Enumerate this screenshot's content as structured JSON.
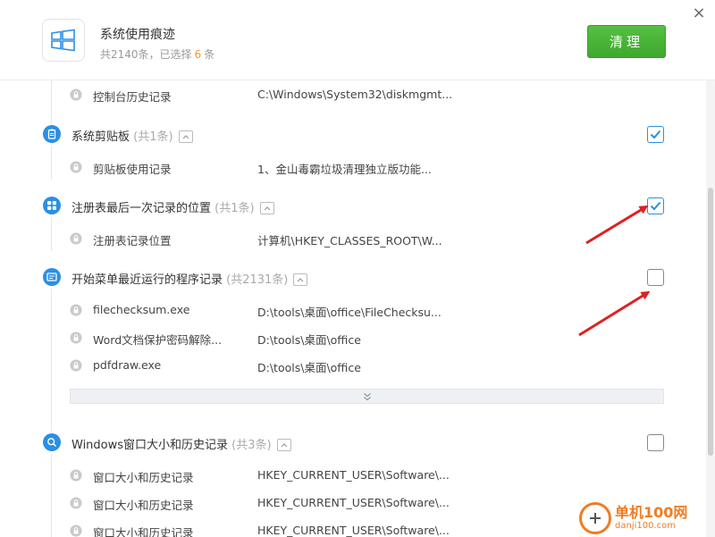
{
  "header": {
    "title": "系统使用痕迹",
    "subtitle_prefix": "共2140条，已选择",
    "selected_count": "6",
    "subtitle_suffix": "条",
    "clean_label": "清理",
    "close_glyph": "×"
  },
  "colors": {
    "accent_blue": "#2b8fe5",
    "clean_green": "#4cb63b",
    "selected_orange": "#f39a2b",
    "arrow_red": "#e02020"
  },
  "top_row": {
    "name": "控制台历史记录",
    "path": "C:\\Windows\\System32\\diskmgmt..."
  },
  "categories": [
    {
      "label": "系统剪贴板",
      "count": "(共1条)",
      "checked": true,
      "icon": "clipboard-icon",
      "rows": [
        {
          "name": "剪贴板使用记录",
          "path": "1、金山毒霸垃圾清理独立版功能..."
        }
      ]
    },
    {
      "label": "注册表最后一次记录的位置",
      "count": "(共1条)",
      "checked": true,
      "icon": "registry-icon",
      "rows": [
        {
          "name": "注册表记录位置",
          "path": "计算机\\HKEY_CLASSES_ROOT\\W..."
        }
      ]
    },
    {
      "label": "开始菜单最近运行的程序记录",
      "count": "(共2131条)",
      "checked": false,
      "icon": "start-menu-icon",
      "rows": [
        {
          "name": "filechecksum.exe",
          "path": "D:\\tools\\桌面\\office\\FileChecksu..."
        },
        {
          "name": "Word文档保护密码解除...",
          "path": "D:\\tools\\桌面\\office"
        },
        {
          "name": "pdfdraw.exe",
          "path": "D:\\tools\\桌面\\office"
        }
      ]
    },
    {
      "label": "Windows窗口大小和历史记录",
      "count": "(共3条)",
      "checked": false,
      "icon": "window-search-icon",
      "rows": [
        {
          "name": "窗口大小和历史记录",
          "path": "HKEY_CURRENT_USER\\Software\\..."
        },
        {
          "name": "窗口大小和历史记录",
          "path": "HKEY_CURRENT_USER\\Software\\..."
        },
        {
          "name": "窗口大小和历史记录",
          "path": "HKEY_CURRENT_USER\\Software\\..."
        }
      ]
    }
  ],
  "watermark": {
    "name": "单机100网",
    "url": "danji100.com"
  }
}
